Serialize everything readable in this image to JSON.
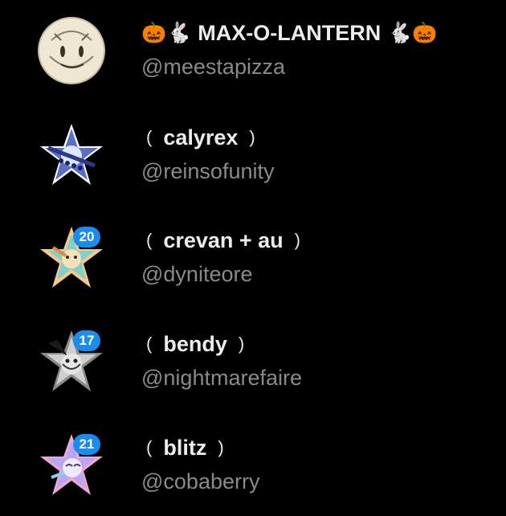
{
  "accounts": [
    {
      "display_name": "MAX-O-LANTERN",
      "emoji_left": [
        "🎃",
        "🐇"
      ],
      "emoji_right": [
        "🐇",
        "🎃"
      ],
      "handle": "@meestapizza",
      "avatar_style": "circle"
    },
    {
      "display_name": "calyrex",
      "paren_open": "(",
      "paren_close": ")",
      "handle": "@reinsofunity",
      "avatar_style": "star"
    },
    {
      "display_name": "crevan + au",
      "paren_open": "(",
      "paren_close": ")",
      "handle": "@dyniteore",
      "badge": "20",
      "avatar_style": "star"
    },
    {
      "display_name": "bendy",
      "paren_open": "(",
      "paren_close": ")",
      "handle": "@nightmarefaire",
      "badge": "17",
      "avatar_style": "star"
    },
    {
      "display_name": "blitz",
      "paren_open": "(",
      "paren_close": ")",
      "handle": "@cobaberry",
      "badge": "21",
      "avatar_style": "star"
    }
  ],
  "colors": {
    "background": "#000000",
    "display_name": "#ececec",
    "handle": "#8a8a8a",
    "badge": "#1a8cf0"
  }
}
